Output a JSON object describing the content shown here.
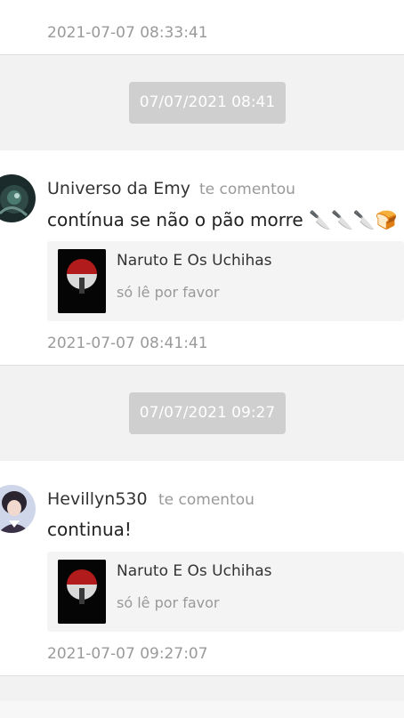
{
  "top_card": {
    "timestamp": "2021-07-07 08:33:41"
  },
  "groups": [
    {
      "date_stamp": "07/07/2021 08:41",
      "comment": {
        "username": "Universo da Emy",
        "action": "te comentou",
        "message": "contínua se não o pão morre 🔪🔪🔪🍞",
        "story": {
          "title": "Naruto E Os Uchihas",
          "subtitle": "só lê por favor"
        },
        "timestamp": "2021-07-07 08:41:41"
      }
    },
    {
      "date_stamp": "07/07/2021 09:27",
      "comment": {
        "username": "Hevillyn530",
        "action": "te comentou",
        "message": "continua!",
        "story": {
          "title": "Naruto E Os Uchihas",
          "subtitle": "só lê por favor"
        },
        "timestamp": "2021-07-07 09:27:07"
      }
    }
  ]
}
